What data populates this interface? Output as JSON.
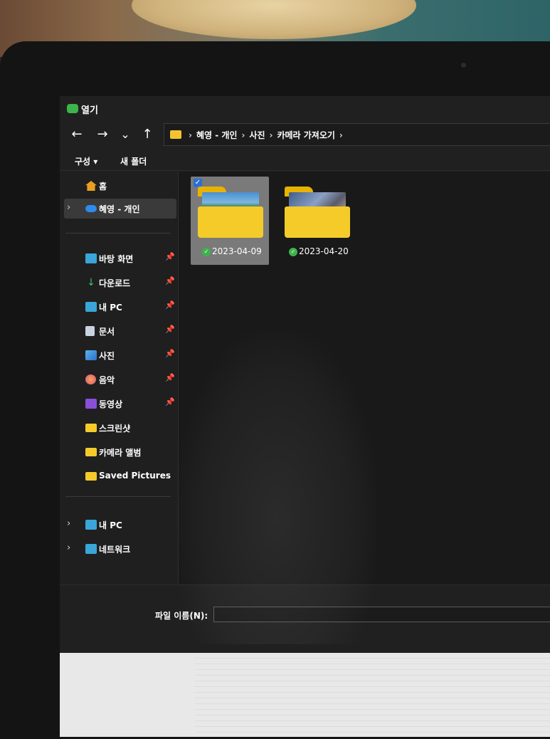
{
  "window": {
    "title": "열기"
  },
  "nav": {
    "back_glyph": "←",
    "forward_glyph": "→",
    "recent_glyph": "⌄",
    "up_glyph": "↑"
  },
  "breadcrumb": [
    "혜영 - 개인",
    "사진",
    "카메라 가져오기"
  ],
  "breadcrumb_separator": "›",
  "commands": {
    "organize": "구성 ▾",
    "new_folder": "새 폴더"
  },
  "sidebar": {
    "items": [
      {
        "label": "홈",
        "icon": "home-icon"
      },
      {
        "label": "혜영 - 개인",
        "icon": "onedrive-cloud-icon",
        "selected": true,
        "chevron": "›"
      }
    ],
    "quick_access": [
      {
        "label": "바탕 화면",
        "icon": "desktop-icon",
        "pinned": true
      },
      {
        "label": "다운로드",
        "icon": "download-icon",
        "pinned": true
      },
      {
        "label": "내 PC",
        "icon": "monitor-icon",
        "pinned": true
      },
      {
        "label": "문서",
        "icon": "document-icon",
        "pinned": true
      },
      {
        "label": "사진",
        "icon": "pictures-icon",
        "pinned": true
      },
      {
        "label": "음악",
        "icon": "music-icon",
        "pinned": true
      },
      {
        "label": "동영상",
        "icon": "video-icon",
        "pinned": true
      },
      {
        "label": "스크린샷",
        "icon": "folder-icon",
        "pinned": false
      },
      {
        "label": "카메라 앨범",
        "icon": "folder-icon",
        "pinned": false
      },
      {
        "label": "Saved Pictures",
        "icon": "folder-icon",
        "pinned": false
      }
    ],
    "locations": [
      {
        "label": "내 PC",
        "icon": "monitor-icon",
        "chevron": "›"
      },
      {
        "label": "네트워크",
        "icon": "network-icon",
        "chevron": "›"
      }
    ],
    "pin_glyph": "📌"
  },
  "content": {
    "folders": [
      {
        "name": "2023-04-09",
        "selected": true,
        "status": "synced"
      },
      {
        "name": "2023-04-20",
        "selected": false,
        "status": "synced"
      }
    ]
  },
  "footer": {
    "filename_label": "파일 이름(N):",
    "filename_value": ""
  },
  "colors": {
    "dialog_bg": "#202020",
    "folder_yellow": "#f5cb2a",
    "accent_blue": "#2b6fd6",
    "sync_green": "#3cb44b"
  }
}
